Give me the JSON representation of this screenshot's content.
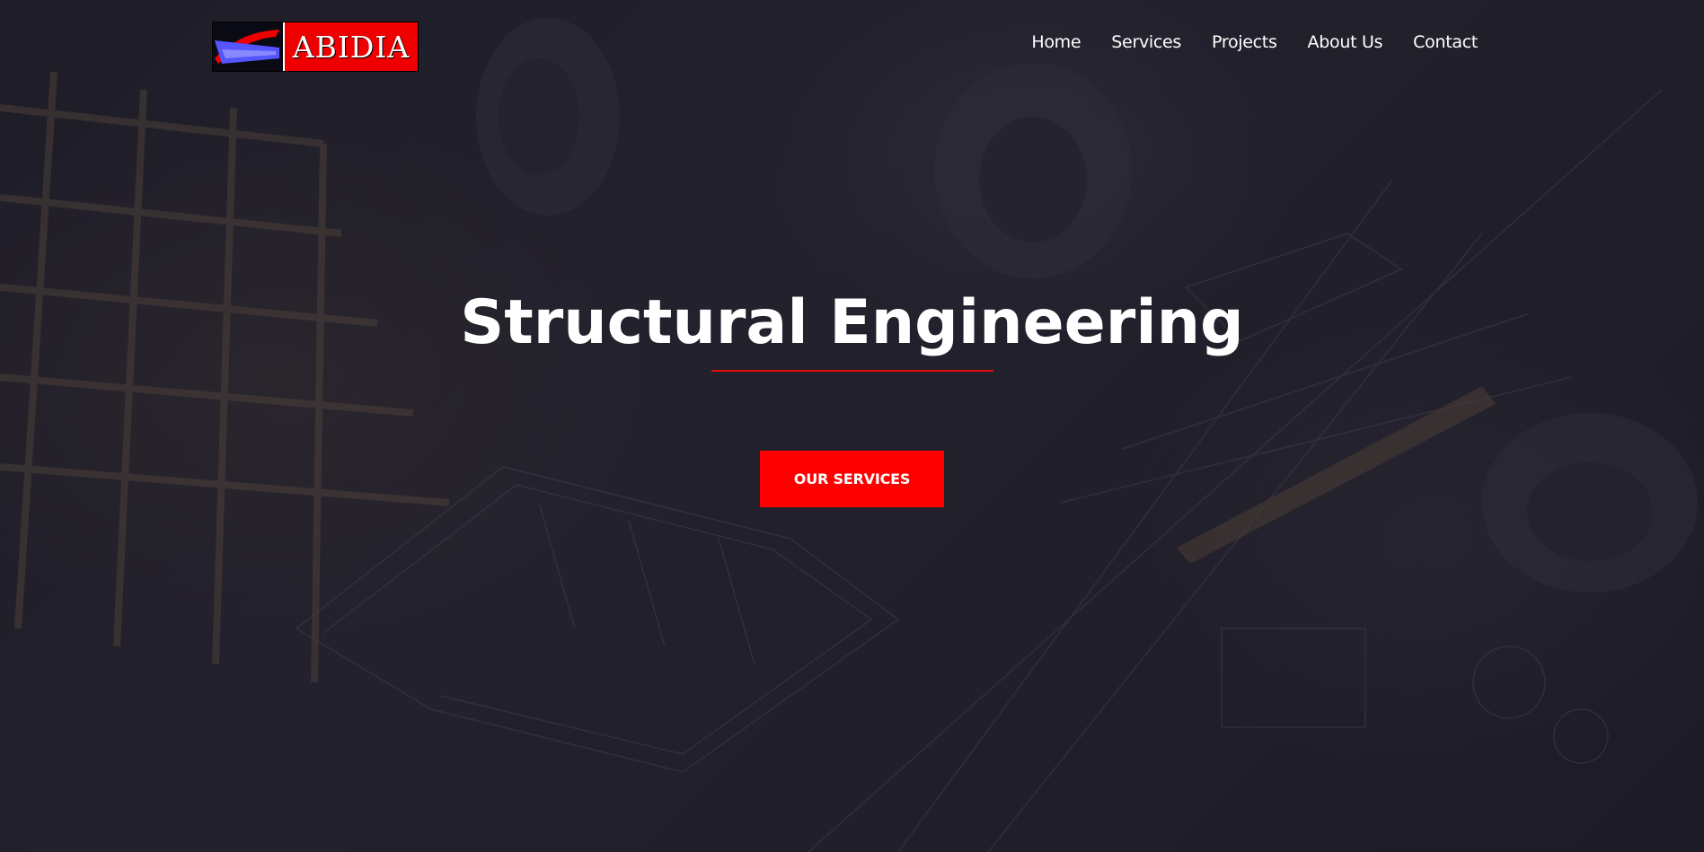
{
  "brand": {
    "name": "ABIDIA",
    "logo_colors": {
      "red": "#ee0000",
      "blue": "#5555ff",
      "dark": "#0a0a14"
    }
  },
  "nav": {
    "items": [
      {
        "label": "Home"
      },
      {
        "label": "Services"
      },
      {
        "label": "Projects"
      },
      {
        "label": "About Us"
      },
      {
        "label": "Contact"
      }
    ]
  },
  "hero": {
    "title": "Structural Engineering",
    "cta_label": "OUR SERVICES",
    "accent_color": "#ff0000",
    "background_image": "construction-blueprint-photo"
  }
}
